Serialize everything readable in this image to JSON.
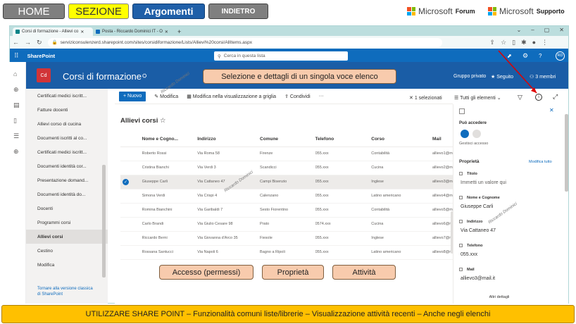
{
  "nav": {
    "home": "HOME",
    "sezione": "SEZIONE",
    "argomenti": "Argomenti",
    "indietro": "INDIETRO"
  },
  "ms": {
    "brand": "Microsoft",
    "forum": "Forum",
    "supporto": "Supporto"
  },
  "browser": {
    "tab1": "Corsi di formazione - Allievi co",
    "tab2": "Posta - Riccardo Dominici IT - O",
    "url": "serviziconsulenzerd.sharepoint.com/sites/corsidiformazione/Lists/Allievi%20corsi/AllItems.aspx"
  },
  "sp": {
    "brand": "SharePoint",
    "search_placeholder": "Cerca in questa lista",
    "avatar": "RD"
  },
  "site": {
    "logo": "Cd",
    "title": "Corsi di formazione",
    "group": "Gruppo privato",
    "follow": "Seguito",
    "members": "3 membri"
  },
  "sidebar": {
    "items": [
      "Certificati medici iscritt...",
      "Fatture docenti",
      "Allievi corso di cucina",
      "Documenti iscritti al co...",
      "Certificati medici iscritt...",
      "Documenti identità cor...",
      "Presentazione domand...",
      "Documenti identità do...",
      "Docenti",
      "Programmi corsi",
      "Allievi corsi",
      "Cestino",
      "Modifica"
    ],
    "classic": "Tornare alla versione classica di SharePoint"
  },
  "cmd": {
    "nuovo": "Nuovo",
    "modifica": "Modifica",
    "griglia": "Modifica nella visualizzazione a griglia",
    "condividi": "Condividi",
    "more": "···",
    "selezionati": "1 selezionati",
    "view": "Tutti gli elementi"
  },
  "list": {
    "title": "Allievi corsi",
    "columns": [
      "Nome e Cogno...",
      "Indirizzo",
      "Comune",
      "Telefono",
      "Corso",
      "Mail"
    ],
    "rows": [
      [
        "Roberto Rossi",
        "Via Roma 58",
        "Firenze",
        "055.xxx",
        "Contabilità",
        "allievo1@ma"
      ],
      [
        "Cristina Bianchi",
        "Via Verdi 3",
        "Scandicci",
        "055.xxx",
        "Cucina",
        "allievo2@ma"
      ],
      [
        "Giuseppe Carli",
        "Via Cattaneo 47",
        "Campi Bisenzio",
        "055.xxx",
        "Inglese",
        "allievo3@ma"
      ],
      [
        "Simona Verdi",
        "Via Crispi 4",
        "Calenzano",
        "055.xxx",
        "Latino americano",
        "allievo4@ma"
      ],
      [
        "Romina Bianchini",
        "Via Garibaldi 7",
        "Sesto Fiorentino",
        "055.xxx",
        "Contabilità",
        "allievo5@ma"
      ],
      [
        "Carlo Brandi",
        "Via Giulio Cesare 98",
        "Prato",
        "0574.xxx",
        "Cucina",
        "allievo6@ma"
      ],
      [
        "Riccardo Berni",
        "Via Giovanna d'Arco 35",
        "Fiesole",
        "055.xxx",
        "Inglese",
        "allievo7@ma"
      ],
      [
        "Rossana Santucci",
        "Via Napoli 6",
        "Bagno a Ripoli",
        "055.xxx",
        "Latino americano",
        "allievo8@ma"
      ]
    ]
  },
  "panel": {
    "access_title": "Può accedere",
    "manage": "Gestisci accesso",
    "props": "Proprietà",
    "edit_all": "Modifica tutto",
    "fields": [
      {
        "label": "Titolo",
        "value": "Immetti un valore qui"
      },
      {
        "label": "Nome e Cognome",
        "value": "Giuseppe Carli"
      },
      {
        "label": "Indirizzo",
        "value": "Via Cattaneo 47"
      },
      {
        "label": "Telefono",
        "value": "055.xxx"
      },
      {
        "label": "Mail",
        "value": "allievo3@mail.it"
      }
    ],
    "more": "Altri dettagli"
  },
  "callouts": {
    "main": "Selezione e dettagli di un singola voce elenco",
    "accesso": "Accesso (permessi)",
    "proprieta": "Proprietà",
    "attivita": "Attività"
  },
  "footer": "UTILIZZARE SHARE POINT – Funzionalità comuni liste/librerie – Visualizzazione attività recenti – Anche negli elenchi",
  "watermark": "Riccardo Dominici",
  "colors": {
    "accent": "#0f6cbd",
    "header": "#1a5da6",
    "callout": "#f8cbad",
    "footer": "#ffc000",
    "sezione": "#ffff00"
  }
}
